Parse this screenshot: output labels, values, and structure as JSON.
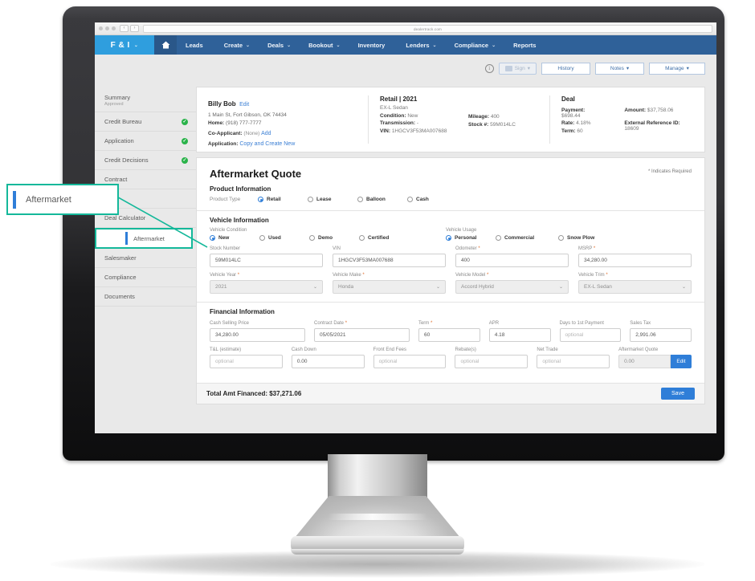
{
  "browser": {
    "url": "dealertrack.com",
    "back_icon": "chevron-left-icon",
    "forward_icon": "chevron-right-icon"
  },
  "nav": {
    "brand": "F & I",
    "brand_caret": "⌄",
    "home_icon": "home-icon",
    "items": [
      {
        "label": "Leads",
        "caret": ""
      },
      {
        "label": "Create",
        "caret": "⌄"
      },
      {
        "label": "Deals",
        "caret": "⌄"
      },
      {
        "label": "Bookout",
        "caret": "⌄"
      },
      {
        "label": "Inventory",
        "caret": ""
      },
      {
        "label": "Lenders",
        "caret": "⌄"
      },
      {
        "label": "Compliance",
        "caret": "⌄"
      },
      {
        "label": "Reports",
        "caret": ""
      }
    ]
  },
  "toolbar": {
    "info_icon": "info-icon",
    "sign_label": "Sign",
    "sign_caret": "▾",
    "history_label": "History",
    "notes_label": "Notes",
    "notes_caret": "▾",
    "manage_label": "Manage",
    "manage_caret": "▾"
  },
  "sidebar": {
    "items": [
      {
        "label": "Summary",
        "sub": "Approved",
        "check": false
      },
      {
        "label": "Credit Bureau",
        "sub": "",
        "check": true
      },
      {
        "label": "Application",
        "sub": "",
        "check": true
      },
      {
        "label": "Credit Decisions",
        "sub": "",
        "check": true
      },
      {
        "label": "Contract",
        "sub": "",
        "check": false
      },
      {
        "label": "",
        "sub": "",
        "check": false
      },
      {
        "label": "Deal Calculator",
        "sub": "",
        "check": false
      },
      {
        "label": "Aftermarket",
        "sub": "",
        "check": false,
        "active": true
      },
      {
        "label": "Salesmaker",
        "sub": "",
        "check": false
      },
      {
        "label": "Compliance",
        "sub": "",
        "check": false
      },
      {
        "label": "Documents",
        "sub": "",
        "check": false
      }
    ],
    "check_glyph": "✓"
  },
  "callout": {
    "label": "Aftermarket",
    "border_color": "#14b89a",
    "accent_color": "#2f7ed8"
  },
  "customer": {
    "name": "Billy Bob",
    "edit_link": "Edit",
    "address": "1 Main St, Fort Gibson, OK 74434",
    "home_label": "Home:",
    "home_phone": "(918) 777-7777",
    "coapplicant_label": "Co-Applicant:",
    "coapplicant_value": "(None)",
    "coapplicant_add": "Add",
    "application_label": "Application:",
    "application_link": "Copy and Create New"
  },
  "vehicle_summary": {
    "title": "Retail | 2021",
    "trim": "EX-L Sedan",
    "condition_label": "Condition:",
    "condition_value": "New",
    "transmission_label": "Transmission:",
    "transmission_value": "-",
    "vin_label": "VIN:",
    "vin_value": "1HGCV3F53MA007688",
    "mileage_label": "Mileage:",
    "mileage_value": "400",
    "stock_label": "Stock #:",
    "stock_value": "59M014LC"
  },
  "deal_summary": {
    "title": "Deal",
    "payment_label": "Payment:",
    "payment_value": "$698.44",
    "rate_label": "Rate:",
    "rate_value": "4.18%",
    "term_label": "Term:",
    "term_value": "60",
    "amount_label": "Amount:",
    "amount_value": "$37,758.06",
    "ext_ref_label": "External Reference ID:",
    "ext_ref_value": "18609"
  },
  "form": {
    "title": "Aftermarket Quote",
    "required_note": "* Indicates Required",
    "product_section": "Product Information",
    "product_type_label": "Product Type",
    "product_types": [
      {
        "label": "Retail",
        "selected": true
      },
      {
        "label": "Lease",
        "selected": false
      },
      {
        "label": "Balloon",
        "selected": false
      },
      {
        "label": "Cash",
        "selected": false
      }
    ],
    "vehicle_section": "Vehicle Information",
    "vehicle_condition_label": "Vehicle Condition",
    "vehicle_conditions": [
      {
        "label": "New",
        "selected": true
      },
      {
        "label": "Used",
        "selected": false
      },
      {
        "label": "Demo",
        "selected": false
      },
      {
        "label": "Certified",
        "selected": false
      }
    ],
    "vehicle_usage_label": "Vehicle Usage",
    "vehicle_usages": [
      {
        "label": "Personal",
        "selected": true
      },
      {
        "label": "Commercial",
        "selected": false
      },
      {
        "label": "Snow Plow",
        "selected": false
      }
    ],
    "stock_number": {
      "label": "Stock Number",
      "value": "59M014LC",
      "required": false,
      "placeholder": ""
    },
    "vin": {
      "label": "VIN",
      "value": "1HGCV3F53MA007688",
      "required": false,
      "placeholder": ""
    },
    "odometer": {
      "label": "Odometer",
      "value": "400",
      "required": true,
      "placeholder": ""
    },
    "msrp": {
      "label": "MSRP",
      "value": "34,280.00",
      "required": true,
      "placeholder": ""
    },
    "vehicle_year": {
      "label": "Vehicle Year",
      "value": "2021",
      "required": true
    },
    "vehicle_make": {
      "label": "Vehicle Make",
      "value": "Honda",
      "required": true
    },
    "vehicle_model": {
      "label": "Vehicle Model",
      "value": "Accord Hybrid",
      "required": true
    },
    "vehicle_trim": {
      "label": "Vehicle Trim",
      "value": "EX-L Sedan",
      "required": true
    },
    "financial_section": "Financial Information",
    "cash_selling_price": {
      "label": "Cash Selling Price",
      "value": "34,280.00",
      "required": false
    },
    "contract_date": {
      "label": "Contract Date",
      "value": "05/05/2021",
      "required": true
    },
    "term": {
      "label": "Term",
      "value": "60",
      "required": true
    },
    "apr": {
      "label": "APR",
      "value": "4.18",
      "required": false
    },
    "days_to_first_payment": {
      "label": "Days to 1st Payment",
      "value": "optional",
      "required": false,
      "empty": true
    },
    "sales_tax": {
      "label": "Sales Tax",
      "value": "2,991.06",
      "required": false
    },
    "tl_estimate": {
      "label": "T&L (estimate)",
      "value": "optional",
      "required": false,
      "empty": true
    },
    "cash_down": {
      "label": "Cash Down",
      "value": "0.00",
      "required": false
    },
    "front_end_fees": {
      "label": "Front End Fees",
      "value": "optional",
      "required": false,
      "empty": true
    },
    "rebates": {
      "label": "Rebate(s)",
      "value": "optional",
      "required": false,
      "empty": true
    },
    "net_trade": {
      "label": "Net Trade",
      "value": "optional",
      "required": false,
      "empty": true
    },
    "aftermarket_quote": {
      "label": "Aftermarket Quote",
      "value": "0.00",
      "required": false
    },
    "edit_button": "Edit",
    "total_label": "Total Amt Financed: $37,271.06",
    "save_button": "Save",
    "dropdown_caret": "⌄"
  }
}
